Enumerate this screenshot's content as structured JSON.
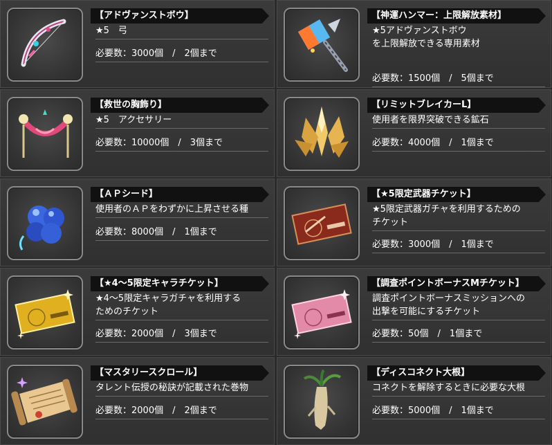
{
  "items": [
    {
      "title": "【アドヴァンストボウ】",
      "desc": "★5　弓",
      "req": "必要数：3000個　/　2個まで",
      "icon": "bow-icon"
    },
    {
      "title": "【神運ハンマー：上限解放素材】",
      "desc": "★5アドヴァンストボウ\nを上限解放できる専用素材",
      "req": "必要数：1500個　/　5個まで",
      "icon": "hammer-icon"
    },
    {
      "title": "【救世の胸飾り】",
      "desc": "★5　アクセサリー",
      "req": "必要数：10000個　/　3個まで",
      "icon": "necklace-icon"
    },
    {
      "title": "【リミットブレイカーL】",
      "desc": "使用者を限界突破できる鉱石",
      "req": "必要数：4000個　/　1個まで",
      "icon": "crystal-icon"
    },
    {
      "title": "【ＡＰシード】",
      "desc": "使用者のＡＰをわずかに上昇させる種",
      "req": "必要数：8000個　/　1個まで",
      "icon": "seed-icon"
    },
    {
      "title": "【★5限定武器チケット】",
      "desc": "★5限定武器ガチャを利用するための\nチケット",
      "req": "必要数：3000個　/　1個まで",
      "icon": "weapon-ticket-icon"
    },
    {
      "title": "【★4～5限定キャラチケット】",
      "desc": "★4～5限定キャラガチャを利用する\nためのチケット",
      "req": "必要数：2000個　/　3個まで",
      "icon": "gold-ticket-icon"
    },
    {
      "title": "【調査ポイントボーナスMチケット】",
      "desc": "調査ポイントボーナスミッションへの\n出撃を可能にするチケット",
      "req": "必要数：50個　/　1個まで",
      "icon": "pink-ticket-icon"
    },
    {
      "title": "【マスタリースクロール】",
      "desc": "タレント伝授の秘訣が記載された巻物",
      "req": "必要数：2000個　/　2個まで",
      "icon": "scroll-icon"
    },
    {
      "title": "【ディスコネクト大根】",
      "desc": "コネクトを解除するときに必要な大根",
      "req": "必要数：5000個　/　1個まで",
      "icon": "radish-icon"
    }
  ]
}
